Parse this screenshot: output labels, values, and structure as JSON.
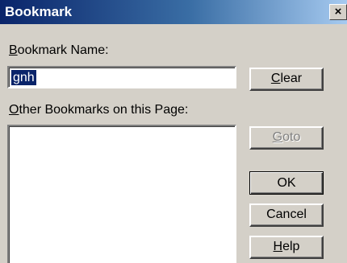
{
  "window": {
    "title": "Bookmark",
    "close_glyph": "×"
  },
  "bookmark_name": {
    "label_prefix": "B",
    "label_rest": "ookmark Name:",
    "value": "gnh"
  },
  "other_bookmarks": {
    "label_prefix": "O",
    "label_rest": "ther Bookmarks on this Page:",
    "items": []
  },
  "buttons": {
    "clear": {
      "prefix": "C",
      "rest": "lear"
    },
    "goto": {
      "prefix": "G",
      "rest": "oto"
    },
    "ok": {
      "label": "OK"
    },
    "cancel": {
      "label": "Cancel"
    },
    "help": {
      "prefix": "H",
      "rest": "elp"
    }
  }
}
